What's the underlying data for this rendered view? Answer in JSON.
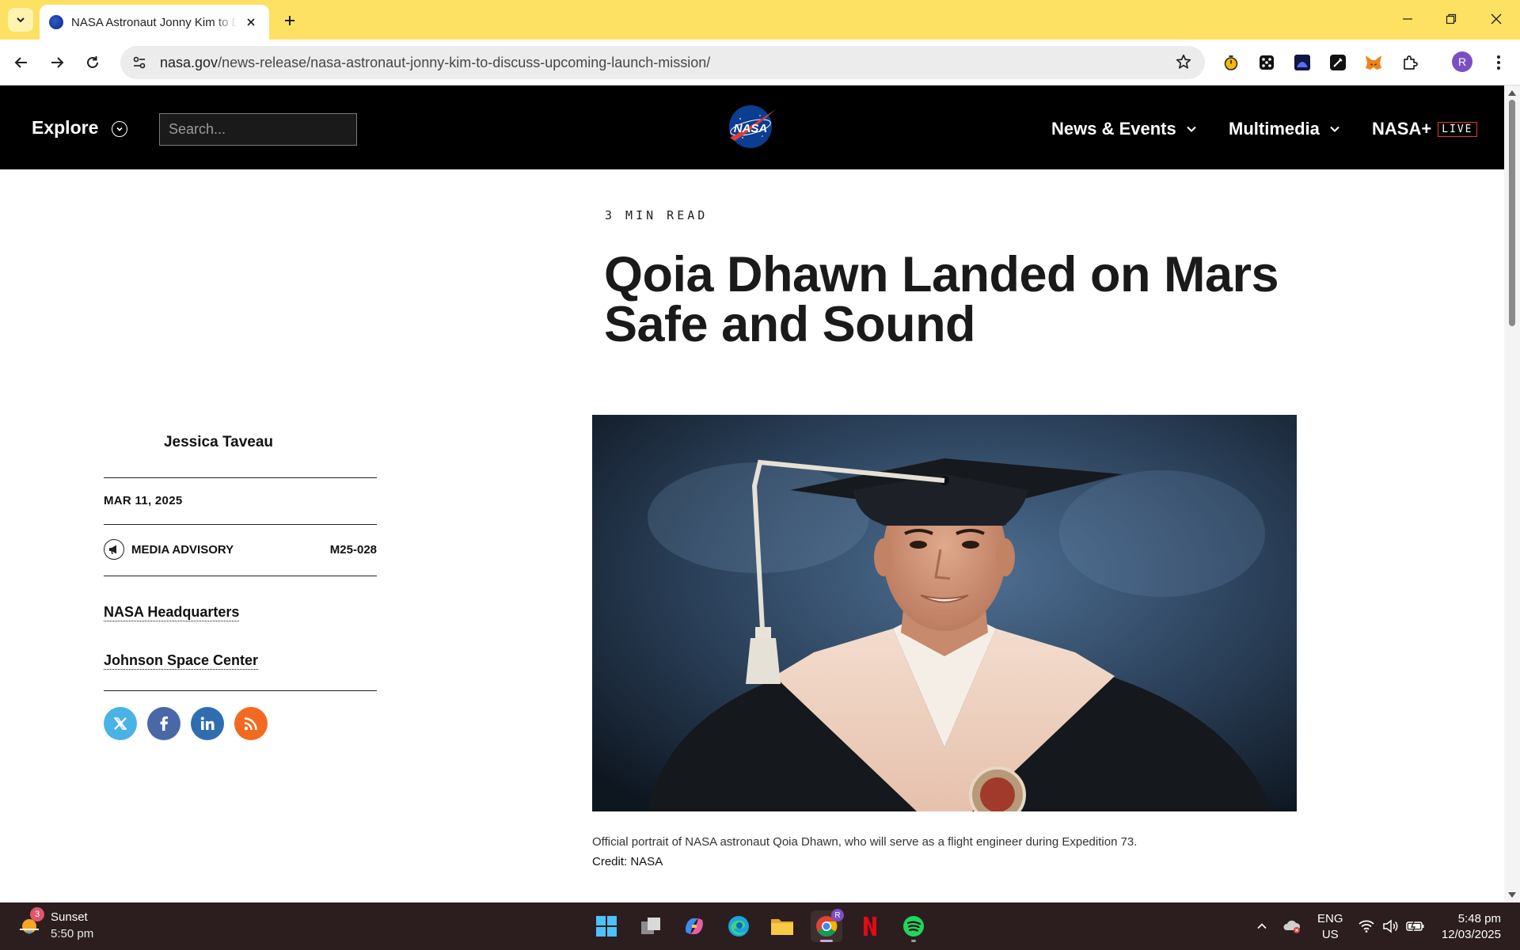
{
  "browser": {
    "tab_title": "NASA Astronaut Jonny Kim to Discuss Upcoming Launch Mission",
    "url_domain": "nasa.gov",
    "url_path": "/news-release/nasa-astronaut-jonny-kim-to-discuss-upcoming-launch-mission/",
    "profile_initial": "R",
    "theme_color": "#fde163"
  },
  "header": {
    "explore_label": "Explore",
    "search_placeholder": "Search...",
    "logo_text": "NASA",
    "menu": [
      {
        "label": "News & Events"
      },
      {
        "label": "Multimedia"
      },
      {
        "label": "NASA+"
      }
    ],
    "live_badge": "LIVE"
  },
  "article": {
    "read_time": "3 MIN READ",
    "title": "Qoia Dhawn Landed on Mars Safe and Sound",
    "author": "Jessica Taveau",
    "date": "MAR 11, 2025",
    "type": "MEDIA ADVISORY",
    "code": "M25-028",
    "centers": [
      "NASA Headquarters",
      "Johnson Space Center"
    ],
    "social": [
      "x-icon",
      "facebook-icon",
      "linkedin-icon",
      "rss-icon"
    ],
    "image_caption": "Official portrait of NASA astronaut Qoia Dhawn, who will serve as a flight engineer during Expedition 73.",
    "image_credit": "Credit: NASA"
  },
  "taskbar": {
    "weather_label": "Sunset",
    "weather_time": "5:50 pm",
    "weather_badge": "3",
    "lang_line1": "ENG",
    "lang_line2": "US",
    "clock_time": "5:48 pm",
    "clock_date": "12/03/2025",
    "chrome_badge": "R"
  }
}
